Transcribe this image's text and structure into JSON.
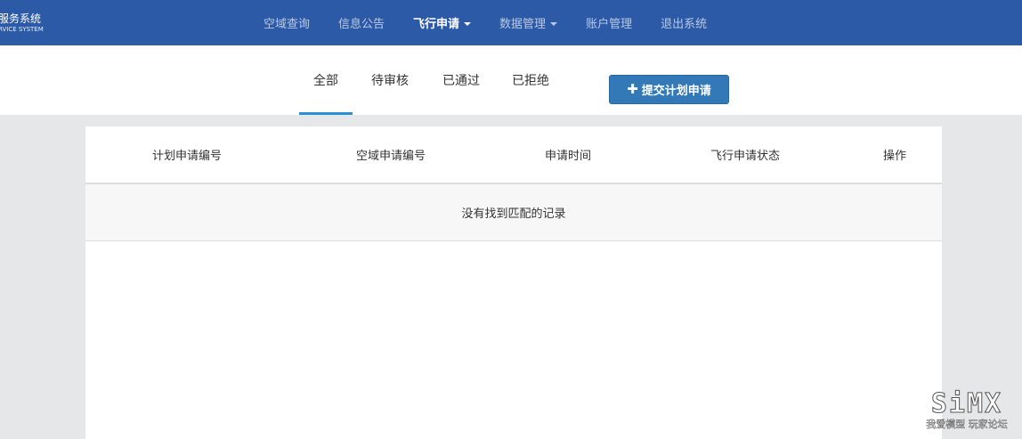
{
  "brand": {
    "title_cn": "服务系统",
    "title_en": "RVICE SYSTEM"
  },
  "nav": {
    "items": [
      {
        "label": "空域查询",
        "active": false,
        "dropdown": false
      },
      {
        "label": "信息公告",
        "active": false,
        "dropdown": false
      },
      {
        "label": "飞行申请",
        "active": true,
        "dropdown": true
      },
      {
        "label": "数据管理",
        "active": false,
        "dropdown": true
      },
      {
        "label": "账户管理",
        "active": false,
        "dropdown": false
      },
      {
        "label": "退出系统",
        "active": false,
        "dropdown": false
      }
    ]
  },
  "tabs": {
    "items": [
      {
        "label": "全部",
        "active": true
      },
      {
        "label": "待审核",
        "active": false
      },
      {
        "label": "已通过",
        "active": false
      },
      {
        "label": "已拒绝",
        "active": false
      }
    ]
  },
  "actions": {
    "submit_label": "提交计划申请",
    "submit_icon": "plus-icon"
  },
  "table": {
    "columns": [
      "计划申请编号",
      "空域申请编号",
      "申请时间",
      "飞行申请状态",
      "操作"
    ],
    "empty_text": "没有找到匹配的记录",
    "rows": []
  },
  "watermark": {
    "logo": "SiMX",
    "subtitle": "我爱模型 玩家论坛"
  },
  "colors": {
    "nav_bg": "#2c5aa6",
    "tab_underline": "#2b8fd6",
    "button_bg": "#3379b8",
    "page_bg": "#e6e7e8"
  }
}
